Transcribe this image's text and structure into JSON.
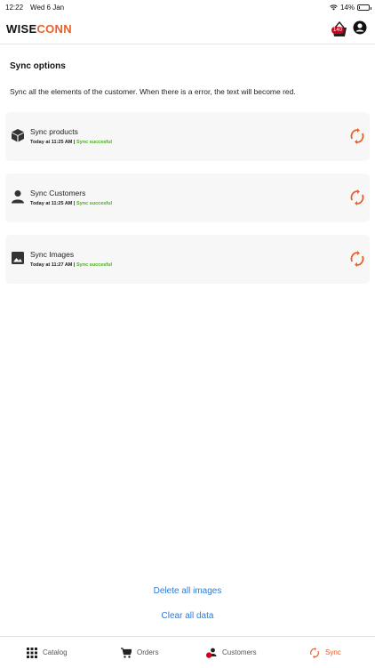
{
  "status": {
    "time": "12:22",
    "date": "Wed 6 Jan",
    "battery": "14%",
    "battery_level": 0.14
  },
  "header": {
    "logo_part1": "WISE",
    "logo_part2": "CONN",
    "cart_badge": "140"
  },
  "page": {
    "title": "Sync options",
    "description": "Sync all the elements of the customer. When there is a error, the text will become red."
  },
  "items": [
    {
      "name": "Sync products",
      "time": "Today at 11:25 AM |",
      "status": "Sync succesful",
      "icon": "cube-icon"
    },
    {
      "name": "Sync Customers",
      "time": "Today at 11:25 AM |",
      "status": "Sync succesful",
      "icon": "person-icon"
    },
    {
      "name": "Sync Images",
      "time": "Today at 11:27 AM |",
      "status": "Sync succesful",
      "icon": "image-icon"
    }
  ],
  "actions": {
    "delete_images": "Delete all images",
    "clear_data": "Clear all data"
  },
  "tabs": [
    {
      "label": "Catalog",
      "icon": "grid-icon"
    },
    {
      "label": "Orders",
      "icon": "cart-icon"
    },
    {
      "label": "Customers",
      "icon": "customers-icon"
    },
    {
      "label": "Sync",
      "icon": "sync-icon",
      "active": true
    }
  ],
  "colors": {
    "accent": "#e8612c",
    "success": "#4cad1e",
    "link": "#2f7ad8",
    "badge": "#d0021b"
  }
}
